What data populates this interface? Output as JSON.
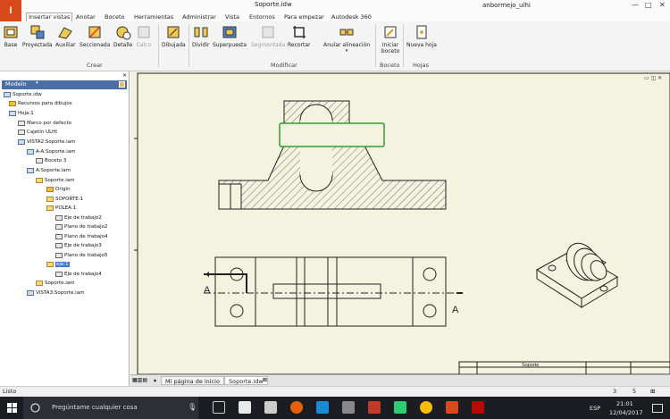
{
  "window": {
    "title": "Soporte.idw",
    "user": "anbormejo_ulhi"
  },
  "tabs": [
    {
      "label": "Insertar vistas",
      "active": true
    },
    {
      "label": "Anotar"
    },
    {
      "label": "Boceto"
    },
    {
      "label": "Herramientas"
    },
    {
      "label": "Administrar"
    },
    {
      "label": "Vista"
    },
    {
      "label": "Entornos"
    },
    {
      "label": "Para empezar"
    },
    {
      "label": "Autodesk 360"
    }
  ],
  "ribbon": {
    "crear": {
      "label": "Crear",
      "buttons": [
        "Base",
        "Proyectada",
        "Auxiliar",
        "Seccionada",
        "Detalle",
        "Calco",
        "Dibujada"
      ]
    },
    "modificar": {
      "label": "Modificar",
      "buttons": [
        "Dividir",
        "Superpuesta",
        "Segmentada",
        "Recortar",
        "Anular alineación"
      ]
    },
    "boceto": {
      "label": "Boceto",
      "buttons": [
        "Iniciar boceto"
      ]
    },
    "hojas": {
      "label": "Hojas",
      "buttons": [
        "Nueva hoja"
      ]
    }
  },
  "panel": {
    "title": "Modelo",
    "items": [
      "Soporte.idw",
      "Recursos para dibujos",
      "Hoja:1",
      "Marco por defecto",
      "Cajetín ULHI",
      "VISTA2:Soporte.iam",
      "A-A:Soporte.iam",
      "Boceto 3",
      "A:Soporte.iam",
      "Soporte.iam",
      "Origin",
      "SOPORTE:1",
      "POLEA:1",
      "Eje de trabajo2",
      "Plano de trabajo2",
      "Plano de trabajo4",
      "Eje de trabajo3",
      "Plano de trabajo5",
      "eje:1",
      "Eje de trabajo4",
      "Soporte.iam",
      "VISTA3:Soporte.iam"
    ]
  },
  "drawing": {
    "section_label": "A",
    "title_block_text": "Soporte"
  },
  "doc_tabs": [
    "Mi página de inicio",
    "Soporte.idw"
  ],
  "status": {
    "text": "Listo",
    "num1": "3",
    "num2": "5"
  },
  "taskbar": {
    "search_placeholder": "Pregúntame cualquier cosa",
    "lang": "ESP",
    "time": "21:01",
    "date": "12/04/2017"
  }
}
